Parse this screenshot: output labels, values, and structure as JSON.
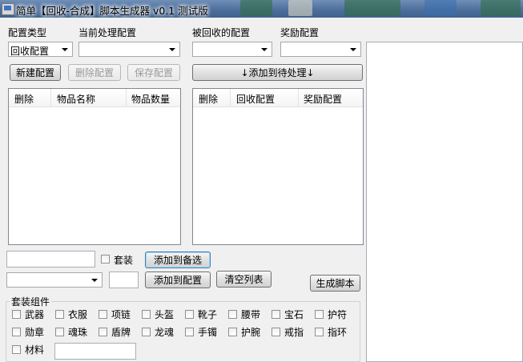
{
  "window": {
    "title": "简单【回收-合成】脚本生成器 v0.1 测试版"
  },
  "left_panel": {
    "config_type_label": "配置类型",
    "current_config_label": "当前处理配置",
    "config_type_value": "回收配置",
    "current_config_value": "",
    "new_button": "新建配置",
    "delete_button": "删除配置",
    "save_button": "保存配置",
    "columns": [
      "删除",
      "物品名称",
      "物品数量"
    ]
  },
  "middle_panel": {
    "recycled_label": "被回收的配置",
    "reward_label": "奖励配置",
    "recycled_value": "",
    "reward_value": "",
    "add_pending_button": "↓添加到待处理↓",
    "columns": [
      "删除",
      "回收配置",
      "奖励配置"
    ]
  },
  "bottom": {
    "item_name_value": "",
    "set_checkbox_label": "套装",
    "add_candidate_button": "添加到备选",
    "item_select_value": "",
    "quantity_value": "",
    "add_config_button": "添加到配置",
    "clear_list_button": "清空列表",
    "generate_button": "生成脚本"
  },
  "set_components": {
    "title": "套装组件",
    "items": [
      "武器",
      "衣服",
      "项链",
      "头盔",
      "靴子",
      "腰带",
      "宝石",
      "护符",
      "勋章",
      "魂珠",
      "盾牌",
      "龙魂",
      "手镯",
      "护腕",
      "戒指",
      "指环",
      "材料"
    ],
    "material_value": ""
  }
}
